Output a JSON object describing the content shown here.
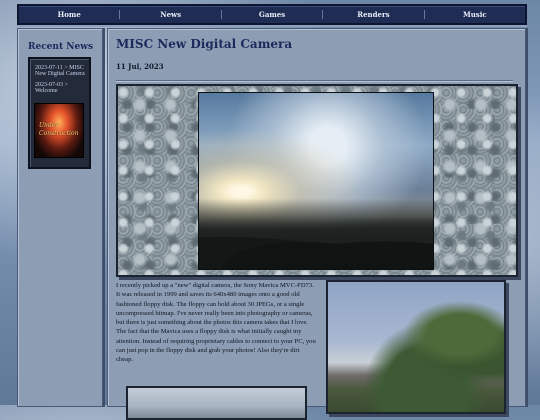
{
  "nav": {
    "items": [
      {
        "label": "Home"
      },
      {
        "label": "News"
      },
      {
        "label": "Games"
      },
      {
        "label": "Renders"
      },
      {
        "label": "Music"
      }
    ]
  },
  "sidebar": {
    "title": "Recent News",
    "links": [
      {
        "label": "2023-07-11 > MISC New Digital Camera"
      },
      {
        "label": "2023-07-03 > Welcome"
      }
    ],
    "banner": {
      "line1": "Under",
      "line2": "Construction"
    }
  },
  "post": {
    "title": "MISC New Digital Camera",
    "date": "11 Jul, 2023",
    "body": "I recently picked up a \"new\" digital camera, the Sony Mavica MVC-FD73. It was released in 1999 and saves its 640x480 images onto a good old fashioned floppy disk. The floppy can hold about 30 JPEGs, or a single uncompressed bitmap. I've never really been into photography or cameras, but there is just something about the photos this camera takes that I love. The fact that the Mavica uses a floppy disk is what initially caught my attention. Instead of requiring proprietary cables to connect to your PC, you can just pop in the floppy disk and grab your photos! Also they're dirt cheap."
  }
}
